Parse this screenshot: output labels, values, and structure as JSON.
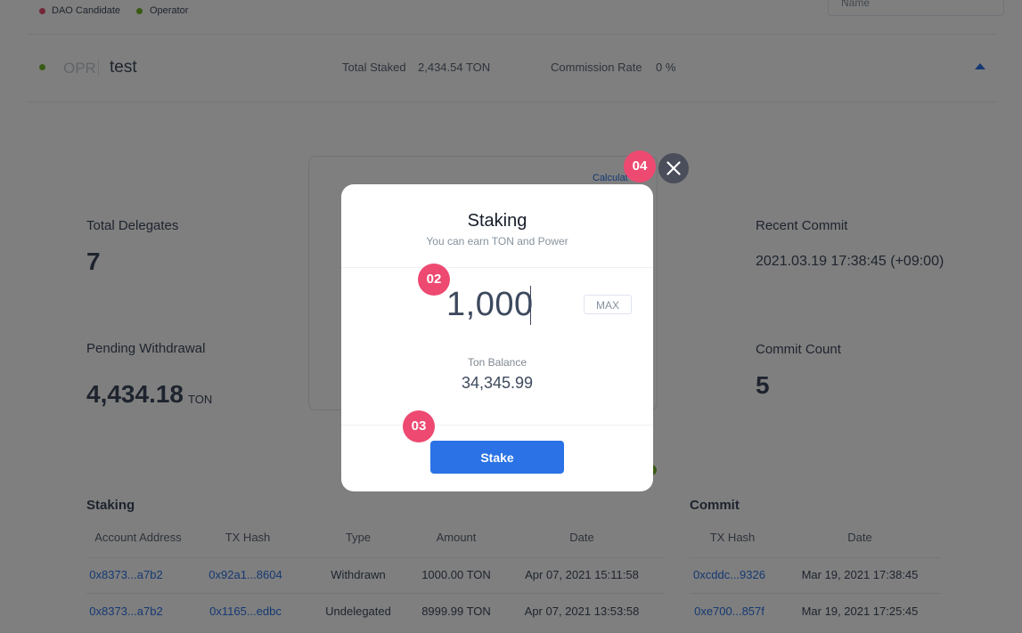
{
  "legend": {
    "items": [
      {
        "label": "DAO Candidate",
        "color": "#e74c6f"
      },
      {
        "label": "Operator",
        "color": "#73b42a"
      }
    ]
  },
  "sort_select": {
    "value": "Name"
  },
  "operator_row": {
    "status_color": "#73b42a",
    "type": "OPR",
    "name": "test",
    "total_staked_label": "Total Staked",
    "total_staked_value": "2,434.54 TON",
    "commission_label": "Commission Rate",
    "commission_value": "0 %"
  },
  "stats": {
    "total_delegates_label": "Total Delegates",
    "total_delegates_value": "7",
    "pending_withdrawal_label": "Pending Withdrawal",
    "pending_withdrawal_value": "4,434.18",
    "pending_withdrawal_unit": "TON",
    "recent_commit_label": "Recent Commit",
    "recent_commit_value": "2021.03.19 17:38:45 (+09:00)",
    "commit_count_label": "Commit Count",
    "commit_count_value": "5",
    "calculator_label": "Calculat"
  },
  "staking_table": {
    "title": "Staking",
    "headers": [
      "Account Address",
      "TX Hash",
      "Type",
      "Amount",
      "Date"
    ],
    "rows": [
      [
        "0x8373...a7b2",
        "0x92a1...8604",
        "Withdrawn",
        "1000.00 TON",
        "Apr 07, 2021 15:11:58"
      ],
      [
        "0x8373...a7b2",
        "0x1165...edbc",
        "Undelegated",
        "8999.99 TON",
        "Apr 07, 2021 13:53:58"
      ]
    ]
  },
  "commit_table": {
    "title": "Commit",
    "headers": [
      "TX Hash",
      "Date"
    ],
    "rows": [
      [
        "0xcddc...9326",
        "Mar 19, 2021 17:38:45"
      ],
      [
        "0xe700...857f",
        "Mar 19, 2021 17:25:45"
      ]
    ]
  },
  "modal": {
    "title": "Staking",
    "subtitle": "You can earn TON and Power",
    "amount": "1,000",
    "max_label": "MAX",
    "balance_label": "Ton Balance",
    "balance_value": "34,345.99",
    "stake_label": "Stake"
  },
  "badges": {
    "amount": "02",
    "stake": "03",
    "close": "04"
  },
  "colors": {
    "accent": "#2a72e5",
    "badge": "#ed4971",
    "overlay": "rgba(0,0,0,0.5)"
  }
}
